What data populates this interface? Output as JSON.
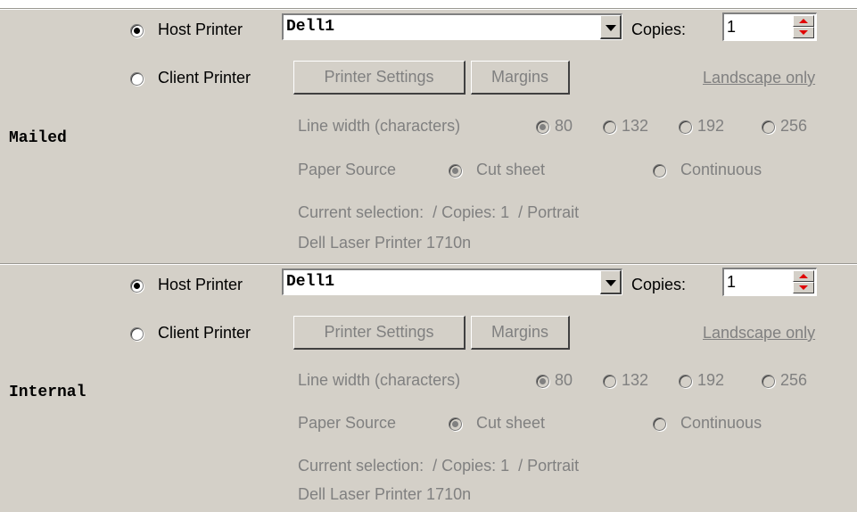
{
  "sections": [
    {
      "label": "Mailed",
      "host_printer_label": "Host Printer",
      "host_printer_value": "Dell1",
      "copies_label": "Copies:",
      "copies_value": "1",
      "client_printer_label": "Client Printer",
      "printer_settings_label": "Printer Settings",
      "margins_label": "Margins",
      "landscape_link": "Landscape only",
      "line_width_label": "Line width (characters)",
      "line_width_options": [
        "80",
        "132",
        "192",
        "256"
      ],
      "line_width_selected": "80",
      "paper_source_label": "Paper Source",
      "paper_source_options": [
        "Cut sheet",
        "Continuous"
      ],
      "paper_source_selected": "Cut sheet",
      "current_selection": "Current selection:  / Copies: 1  / Portrait",
      "printer_name": "Dell Laser Printer 1710n",
      "selected_printer_type": "host"
    },
    {
      "label": "Internal",
      "host_printer_label": "Host Printer",
      "host_printer_value": "Dell1",
      "copies_label": "Copies:",
      "copies_value": "1",
      "client_printer_label": "Client Printer",
      "printer_settings_label": "Printer Settings",
      "margins_label": "Margins",
      "landscape_link": "Landscape only",
      "line_width_label": "Line width (characters)",
      "line_width_options": [
        "80",
        "132",
        "192",
        "256"
      ],
      "line_width_selected": "80",
      "paper_source_label": "Paper Source",
      "paper_source_options": [
        "Cut sheet",
        "Continuous"
      ],
      "paper_source_selected": "Cut sheet",
      "current_selection": "Current selection:  / Copies: 1  / Portrait",
      "printer_name": "Dell Laser Printer 1710n",
      "selected_printer_type": "host"
    }
  ],
  "colors": {
    "panel_bg": "#d4d0c8",
    "disabled_text": "#808080",
    "spinner_arrow": "#e00000"
  },
  "icons": {
    "combo_button": "chevron-down-icon",
    "spin_up": "arrow-up-icon",
    "spin_down": "arrow-down-icon"
  }
}
